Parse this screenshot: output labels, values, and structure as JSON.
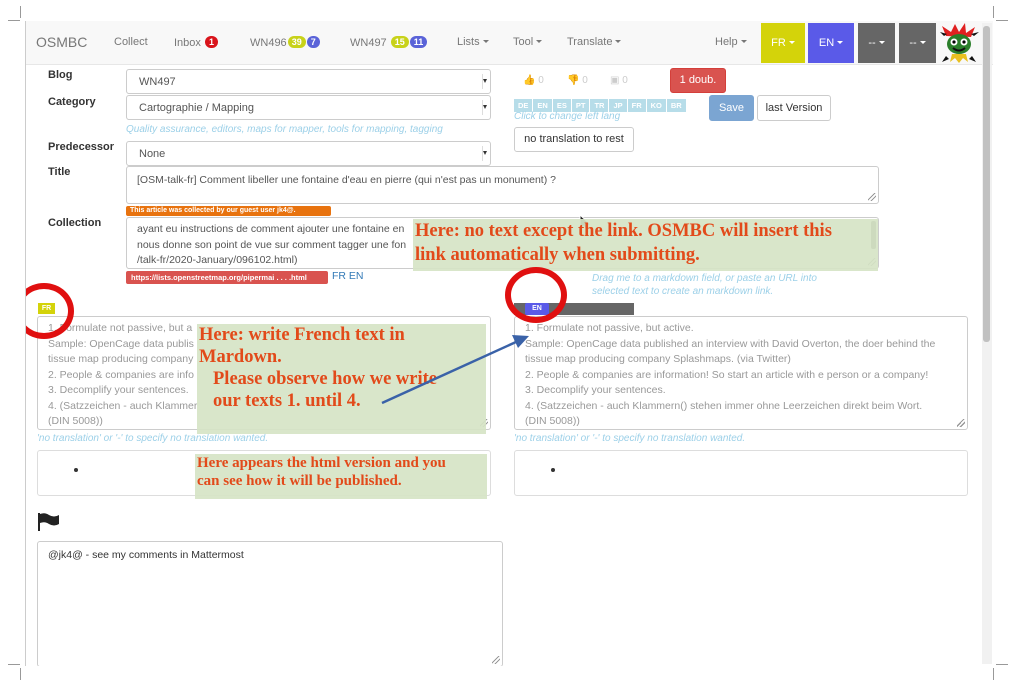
{
  "navbar": {
    "brand": "OSMBC",
    "collect": "Collect",
    "inbox": {
      "label": "Inbox",
      "count": "1"
    },
    "wn496": {
      "label": "WN496",
      "count_a": "39",
      "count_b": "7"
    },
    "wn497": {
      "label": "WN497",
      "count_a": "15",
      "count_b": "11"
    },
    "lists": "Lists",
    "tool": "Tool",
    "translate": "Translate",
    "help": "Help",
    "lang_fr": "FR",
    "lang_en": "EN",
    "lang_3": "--",
    "lang_4": "--",
    "colors": {
      "fr": "#d4d30a",
      "en": "#5a5ae8",
      "gray": "#666666",
      "inbox_badge": "#d9141b",
      "yellow_badge": "#c8d21a",
      "blue_badge": "#5a63d8"
    }
  },
  "form": {
    "blog_label": "Blog",
    "blog_value": "WN497",
    "category_label": "Category",
    "category_value": "Cartographie / Mapping",
    "category_help": "Quality assurance, editors, maps for mapper, tools for mapping, tagging",
    "predecessor_label": "Predecessor",
    "predecessor_value": "None",
    "title_label": "Title",
    "title_value": "[OSM-talk-fr] Comment libeller une fontaine d'eau en pierre (qui n'est pas un monument) ?",
    "collection_label": "Collection",
    "collected_by": "This article was collected by our guest user jk4@.",
    "collection_lines": [
      "ayant eu instructions de comment ajouter une fontaine en",
      "nous donne son point de vue sur comment tagger une fon",
      "/talk-fr/2020-January/096102.html)"
    ],
    "link_label": "https://lists.openstreetmap.org/pipermai . . . .html",
    "link_langs": "FR EN",
    "drag_help_1": "Drag me to a markdown field, or paste an URL into",
    "drag_help_2": "selected text to create an markdown link."
  },
  "right_panel": {
    "votes": {
      "up": "0",
      "down": "0",
      "img": "0"
    },
    "doub_button": "1 doub.",
    "lang_tags": [
      "DE",
      "EN",
      "ES",
      "PT",
      "TR",
      "JP",
      "FR",
      "KO",
      "BR"
    ],
    "lang_help": "Click to change left lang",
    "save_button": "Save",
    "last_version_button": "last Version",
    "no_translation_button": "no translation to rest"
  },
  "editors": {
    "left_tag": "FR",
    "right_tag": "EN",
    "placeholder_lines": [
      "1. Formulate not passive, but active.",
      "Sample: OpenCage data published an interview with David Overton, the doer behind the",
      "tissue map producing company Splashmaps. (via Twitter)",
      "2. People & companies are information! So start an article with e person or a company!",
      "3. Decomplify your sentences.",
      "4. (Satzzeichen - auch Klammern() stehen immer ohne Leerzeichen direkt beim Wort.",
      "(DIN 5008))"
    ],
    "left_partial_lines": [
      "1. Formulate not passive, but a",
      "Sample: OpenCage data publis",
      "tissue map producing company",
      "2. People & companies are info",
      "3. Decomplify your sentences.",
      "4. (Satzzeichen - auch Klammer",
      "(DIN 5008))"
    ],
    "no_translation_help": "'no translation' or '-' to specify no translation wanted."
  },
  "comment": {
    "text": "@jk4@ - see my comments in Mattermost"
  },
  "annotations": {
    "link_note_1": "Here: no text except the link. OSMBC will insert this",
    "link_note_2": "link automatically when submitting.",
    "french_note_1": "Here: write French text in",
    "french_note_2": "Mardown.",
    "french_note_3": "Please observe how we write",
    "french_note_4": "our texts 1. until 4.",
    "html_note_1": "Here appears the html version and you",
    "html_note_2": "can see how it will be published."
  }
}
